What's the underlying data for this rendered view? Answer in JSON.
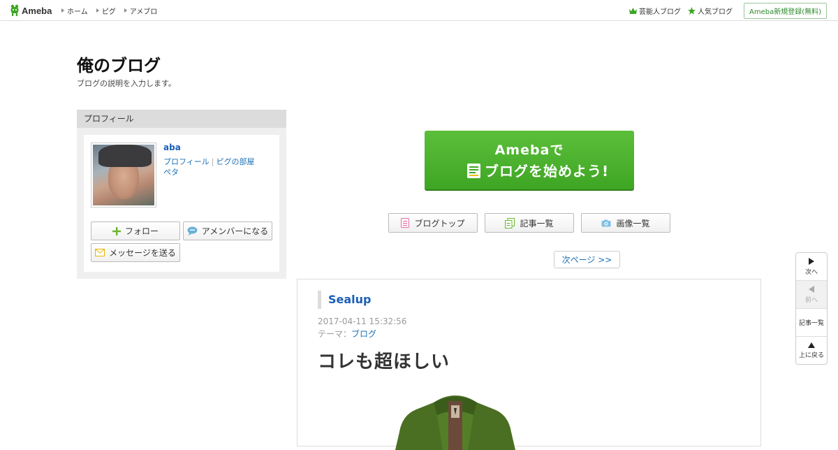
{
  "header": {
    "logo_text": "Ameba",
    "nav": [
      "ホーム",
      "ピグ",
      "アメブロ"
    ],
    "right_links": {
      "celebrity": "芸能人ブログ",
      "popular": "人気ブログ"
    },
    "register": "Ameba新規登録(無料)"
  },
  "blog": {
    "title": "俺のブログ",
    "description": "ブログの説明を入力します。"
  },
  "profile": {
    "heading": "プロフィール",
    "name": "aba",
    "links": {
      "profile": "プロフィール",
      "separator": "|",
      "room": "ピグの部屋",
      "peta": "ペタ"
    },
    "buttons": {
      "follow": "フォロー",
      "amember": "アメンバーになる",
      "message": "メッセージを送る"
    }
  },
  "banner": {
    "line1": "Amebaで",
    "line2": "ブログを始めよう!"
  },
  "blog_nav": {
    "top": "ブログトップ",
    "entries": "記事一覧",
    "images": "画像一覧"
  },
  "pager": {
    "next": "次ページ >>"
  },
  "entry": {
    "blog_name": "Sealup",
    "date": "2017-04-11 15:32:56",
    "theme_label": "テーマ：",
    "theme": "ブログ",
    "title": "コレも超ほしい"
  },
  "side_nav": {
    "next": "次へ",
    "prev": "前へ",
    "list": "記事一覧",
    "top": "上に戻る"
  },
  "colors": {
    "brand_green": "#3ea524",
    "link_blue": "#1a6fb5"
  },
  "icons": [
    "ameba-logo-icon",
    "crown-icon",
    "star-icon",
    "plus-icon",
    "chat-bubble-icon",
    "envelope-icon",
    "notebook-icon",
    "document-icon",
    "camera-icon"
  ]
}
